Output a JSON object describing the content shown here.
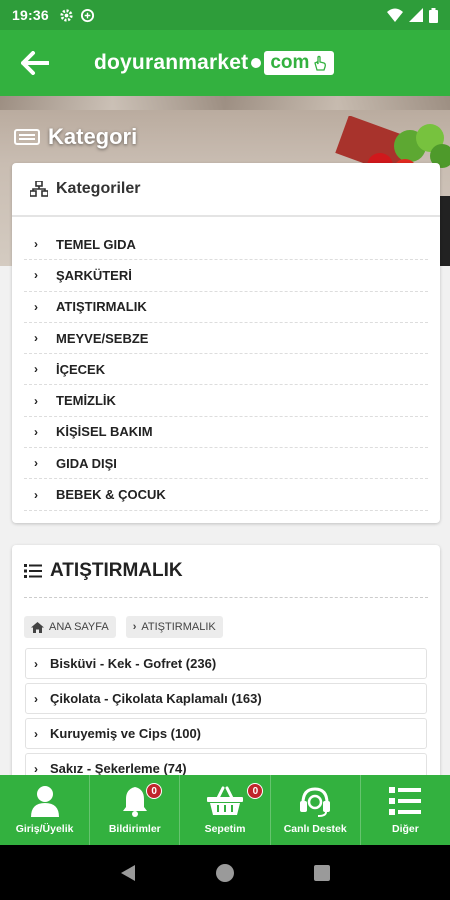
{
  "status": {
    "time": "19:36"
  },
  "header": {
    "logo_word": "doyuranmarket",
    "logo_com": "com"
  },
  "hero": {
    "title": "Kategori"
  },
  "categories": {
    "title": "Kategoriler",
    "items": [
      {
        "label": "TEMEL GIDA"
      },
      {
        "label": "ŞARKÜTERİ"
      },
      {
        "label": "ATIŞTIRMALIK"
      },
      {
        "label": "MEYVE/SEBZE"
      },
      {
        "label": "İÇECEK"
      },
      {
        "label": "TEMİZLİK"
      },
      {
        "label": "KİŞİSEL BAKIM"
      },
      {
        "label": "GIDA DIŞI"
      },
      {
        "label": "BEBEK & ÇOCUK"
      }
    ]
  },
  "section": {
    "title": "ATIŞTIRMALIK",
    "breadcrumb": {
      "home": "ANA SAYFA",
      "current": "ATIŞTIRMALIK"
    },
    "subcategories": [
      {
        "label": "Bisküvi - Kek - Gofret (236)"
      },
      {
        "label": "Çikolata - Çikolata Kaplamalı (163)"
      },
      {
        "label": "Kuruyemiş ve Cips (100)"
      },
      {
        "label": "Sakız - Şekerleme (74)"
      }
    ]
  },
  "bottom_nav": {
    "items": [
      {
        "label": "Giriş/Üyelik",
        "icon": "user-icon"
      },
      {
        "label": "Bildirimler",
        "icon": "bell-icon",
        "badge": "0"
      },
      {
        "label": "Sepetim",
        "icon": "basket-icon",
        "badge": "0"
      },
      {
        "label": "Canlı Destek",
        "icon": "headset-icon"
      },
      {
        "label": "Diğer",
        "icon": "menu-list-icon"
      }
    ]
  },
  "colors": {
    "primary_green": "#33b13f",
    "statusbar_green": "#2e9d3a",
    "badge_red": "#c0262c"
  }
}
